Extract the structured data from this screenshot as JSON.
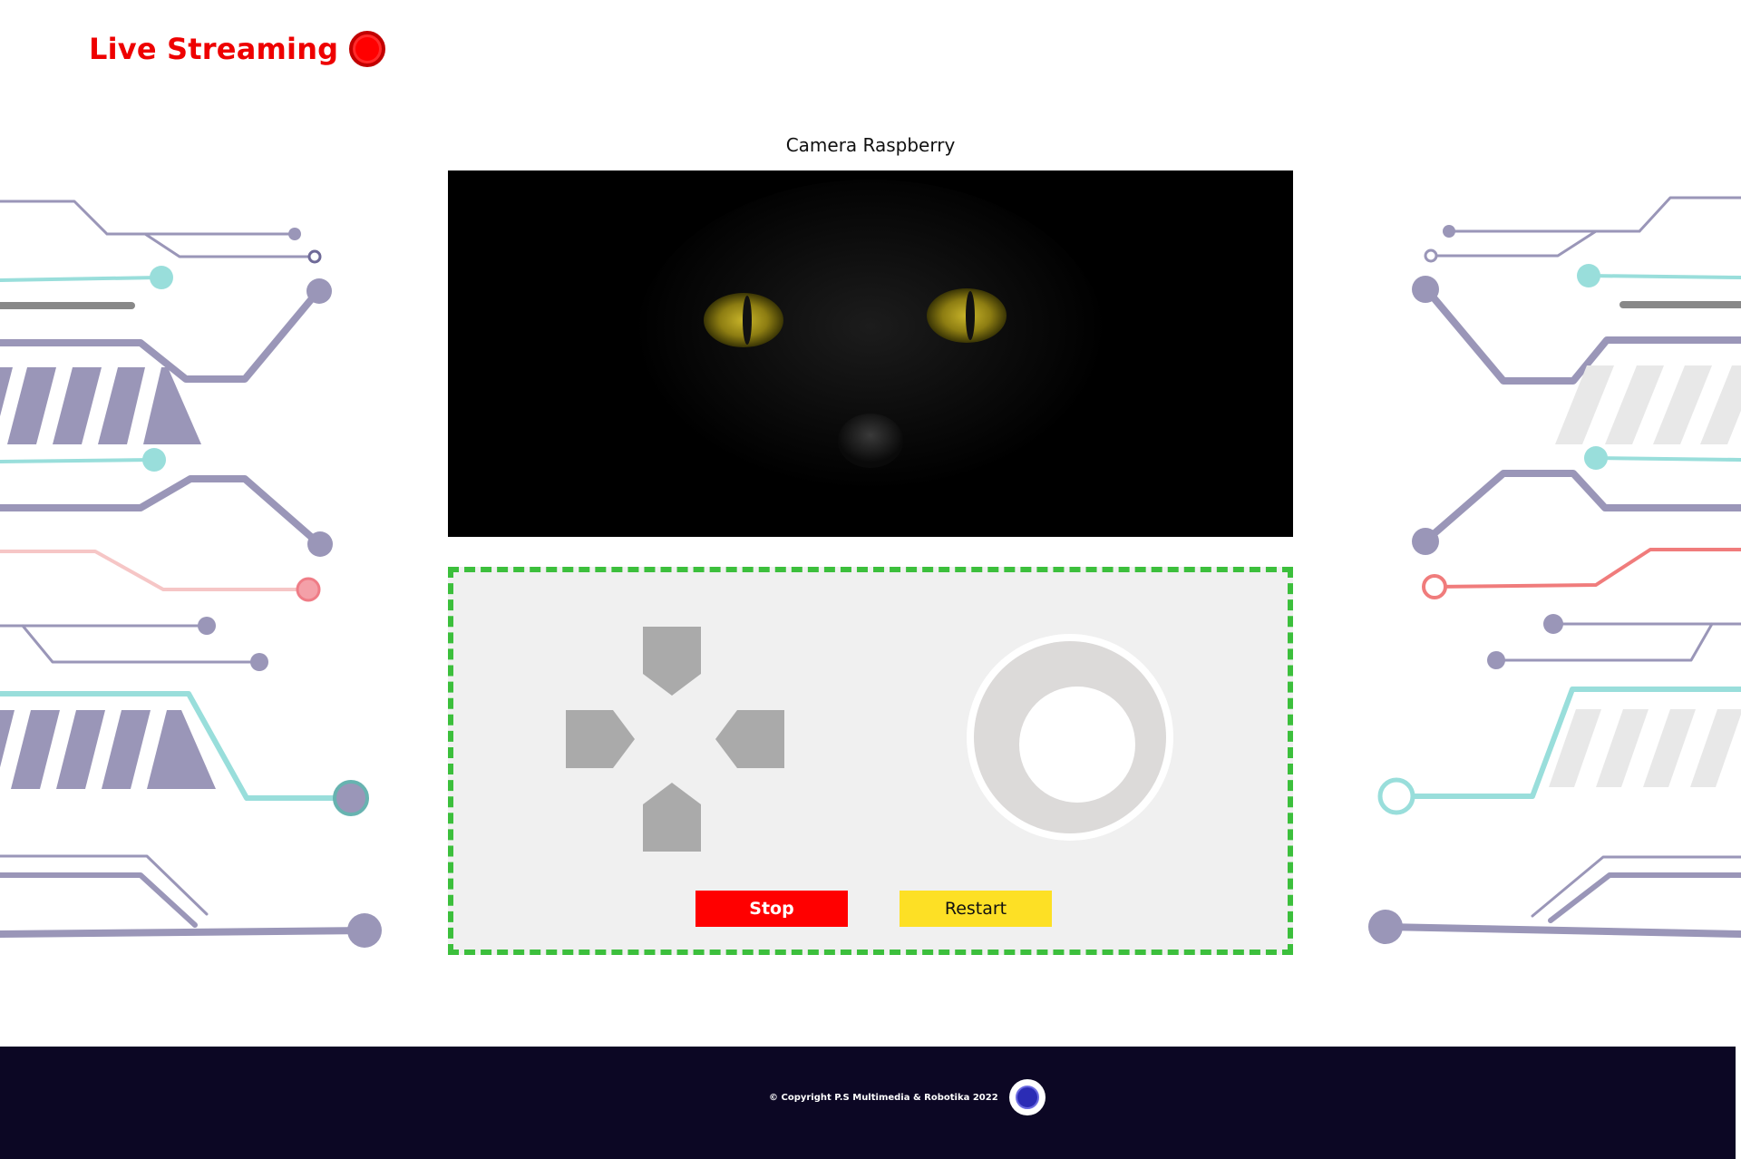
{
  "header": {
    "title": "Live Streaming"
  },
  "camera": {
    "title": "Camera Raspberry"
  },
  "controls": {
    "dpad": [
      "up",
      "left",
      "right",
      "down"
    ],
    "stop_label": "Stop",
    "restart_label": "Restart"
  },
  "footer": {
    "copyright": "© Copyright P.S Multimedia & Robotika 2022"
  },
  "colors": {
    "accent_red": "#ff0000",
    "panel_border": "#3cbf3c",
    "restart_yellow": "#fde025",
    "footer_bg": "#0c0724",
    "circuit_purple": "#9a96b8",
    "circuit_teal": "#99dedb",
    "circuit_pink": "#f08080"
  }
}
